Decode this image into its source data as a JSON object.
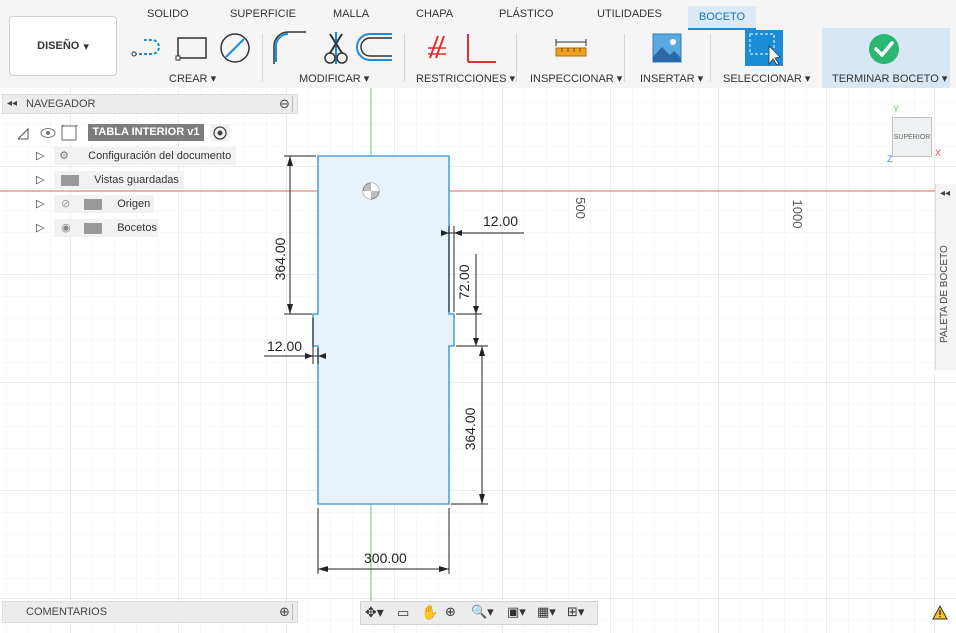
{
  "toolbar": {
    "tabs": [
      "SOLIDO",
      "SUPERFICIE",
      "MALLA",
      "CHAPA",
      "PLÁSTICO",
      "UTILIDADES",
      "BOCETO"
    ],
    "design_label": "DISEÑO",
    "groups": [
      "CREAR",
      "MODIFICAR",
      "RESTRICCIONES",
      "INSPECCIONAR",
      "INSERTAR",
      "SELECCIONAR",
      "TERMINAR BOCETO"
    ],
    "accent": "#1a8cd8",
    "finish_color": "#2bb673"
  },
  "navigator": {
    "title": "NAVEGADOR",
    "root": "TABLA INTERIOR v1",
    "items": [
      {
        "label": "Configuración del documento",
        "icon": "gear-icon"
      },
      {
        "label": "Vistas guardadas",
        "icon": "folder-icon"
      },
      {
        "label": "Origen",
        "icon": "folder-icon",
        "visibility": "hidden"
      },
      {
        "label": "Bocetos",
        "icon": "folder-icon",
        "visibility": "visible"
      }
    ]
  },
  "comments": {
    "title": "COMENTARIOS"
  },
  "side_panel": {
    "title": "PALETA DE BOCETO"
  },
  "view_cube": {
    "face": "SUPERIOR",
    "x": "X",
    "y": "Y",
    "z": "Z"
  },
  "sketch": {
    "dimensions": {
      "top_height": "364.00",
      "bottom_height": "364.00",
      "notch_height": "72.00",
      "left_notch_depth": "12.00",
      "right_notch_depth": "12.00",
      "width": "300.00"
    },
    "ruler": [
      "500",
      "1000"
    ],
    "profile_fill": "#e8f2fb",
    "profile_stroke": "#4aa3df"
  }
}
